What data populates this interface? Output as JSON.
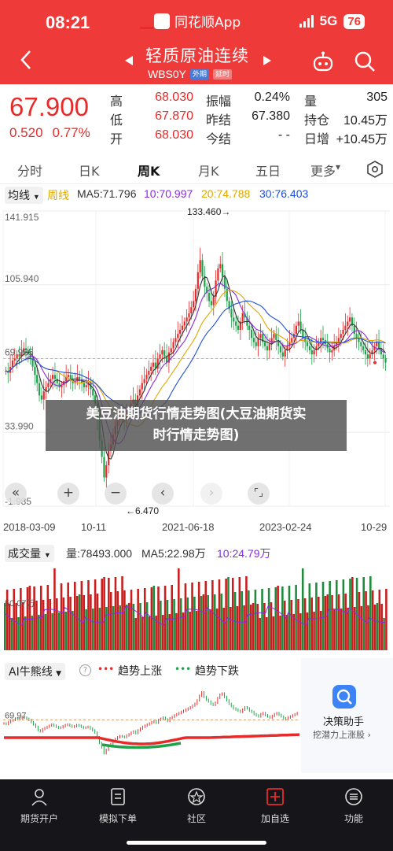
{
  "status_bar": {
    "time": "08:21",
    "app_name": "同花顺App",
    "network": "5G",
    "battery": "76"
  },
  "header": {
    "title": "轻质原油连续",
    "code": "WBS0Y",
    "tag_outer": "外期",
    "tag_continuous": "延时",
    "accent_color": "#ef3a3a"
  },
  "quote": {
    "last_price": "67.900",
    "change": "0.520",
    "change_pct": "0.77%",
    "stats": [
      {
        "label": "高",
        "value": "68.030",
        "color": "red"
      },
      {
        "label": "低",
        "value": "67.870",
        "color": "red"
      },
      {
        "label": "开",
        "value": "68.030",
        "color": "red"
      },
      {
        "label": "振幅",
        "value": "0.24%",
        "color": "dark"
      },
      {
        "label": "昨结",
        "value": "67.380",
        "color": "dark"
      },
      {
        "label": "今结",
        "value": "- -",
        "color": "dark"
      },
      {
        "label": "量",
        "value": "305",
        "color": "dark"
      },
      {
        "label": "持仓",
        "value": "10.45万",
        "color": "dark"
      },
      {
        "label": "日增",
        "value": "+10.45万",
        "color": "dark"
      }
    ]
  },
  "tabs": {
    "items": [
      "分时",
      "日K",
      "周K",
      "月K",
      "五日",
      "更多"
    ],
    "active_index": 2
  },
  "ma_bar": {
    "avg_label": "均线",
    "week_label": "周线",
    "ma5": "MA5:71.796",
    "ma10": "10:70.997",
    "ma20": "20:74.788",
    "ma30": "30:76.403",
    "colors": {
      "ma5": "#333333",
      "ma10": "#8a2be2",
      "ma20": "#e0a800",
      "ma30": "#1d4fd8"
    }
  },
  "main_chart": {
    "y_labels": [
      "141.915",
      "105.940",
      "69.965",
      "33.990",
      "-1.985"
    ],
    "max_marker": "133.460→",
    "min_marker": "←6.470",
    "date_labels": [
      "2018-03-09",
      "10-11",
      "2021-06-18",
      "2023-02-24",
      "10-29"
    ],
    "ref_price": 69.965
  },
  "watermark": {
    "line1": "美豆油期货行情走势图(大豆油期货实",
    "line2": "时行情走势图)"
  },
  "volume": {
    "chip": "成交量",
    "vol": "量:78493.000",
    "ma5": "MA5:22.98万",
    "ma10": "10:24.79万",
    "y_label": "50.07万"
  },
  "ai": {
    "chip": "AI牛熊线",
    "legend_up": "趋势上涨",
    "legend_down": "趋势下跌",
    "y_label": "69.97",
    "decision_title": "决策助手",
    "decision_sub": "挖潜力上涨股 ›"
  },
  "chart_data": [
    {
      "type": "candlestick",
      "title": "轻质原油连续 周K",
      "x_range": [
        "2018-03-09",
        "10-29"
      ],
      "ylim": [
        -1.985,
        141.915
      ],
      "max": 133.46,
      "min": 6.47,
      "closes": [
        64,
        63,
        66,
        69,
        70,
        72,
        71,
        73,
        75,
        74,
        72,
        70,
        66,
        62,
        58,
        52,
        50,
        54,
        56,
        58,
        60,
        62,
        60,
        58,
        56,
        57,
        59,
        61,
        62,
        60,
        58,
        59,
        61,
        60,
        58,
        56,
        57,
        58,
        55,
        52,
        48,
        40,
        30,
        22,
        12,
        18,
        25,
        28,
        33,
        37,
        40,
        42,
        41,
        40,
        43,
        45,
        48,
        50,
        47,
        52,
        55,
        58,
        60,
        62,
        64,
        66,
        68,
        65,
        70,
        72,
        74,
        71,
        68,
        73,
        75,
        78,
        80,
        82,
        84,
        86,
        88,
        90,
        92,
        95,
        98,
        104,
        112,
        118,
        110,
        105,
        102,
        98,
        96,
        100,
        108,
        114,
        116,
        110,
        104,
        98,
        94,
        90,
        88,
        86,
        84,
        88,
        92,
        90,
        86,
        84,
        80,
        78,
        76,
        80,
        82,
        78,
        76,
        74,
        77,
        80,
        82,
        79,
        76,
        73,
        71,
        74,
        76,
        78,
        80,
        82,
        86,
        88,
        84,
        80,
        78,
        76,
        74,
        72,
        74,
        76,
        78,
        80,
        79,
        77,
        75,
        73,
        74,
        76,
        78,
        80,
        82,
        84,
        86,
        88,
        90,
        86,
        82,
        80,
        78,
        76,
        74,
        72,
        70,
        72,
        74,
        76,
        78,
        75,
        72,
        70,
        68
      ]
    },
    {
      "type": "bar",
      "title": "成交量",
      "series": [
        {
          "name": "量",
          "values_note": "weekly volume bars"
        }
      ]
    }
  ],
  "nav": {
    "items": [
      {
        "label": "期货开户",
        "icon": "person-icon"
      },
      {
        "label": "模拟下单",
        "icon": "document-icon"
      },
      {
        "label": "社区",
        "icon": "community-icon"
      },
      {
        "label": "加自选",
        "icon": "add-favorite-icon"
      },
      {
        "label": "功能",
        "icon": "menu-icon"
      }
    ]
  }
}
